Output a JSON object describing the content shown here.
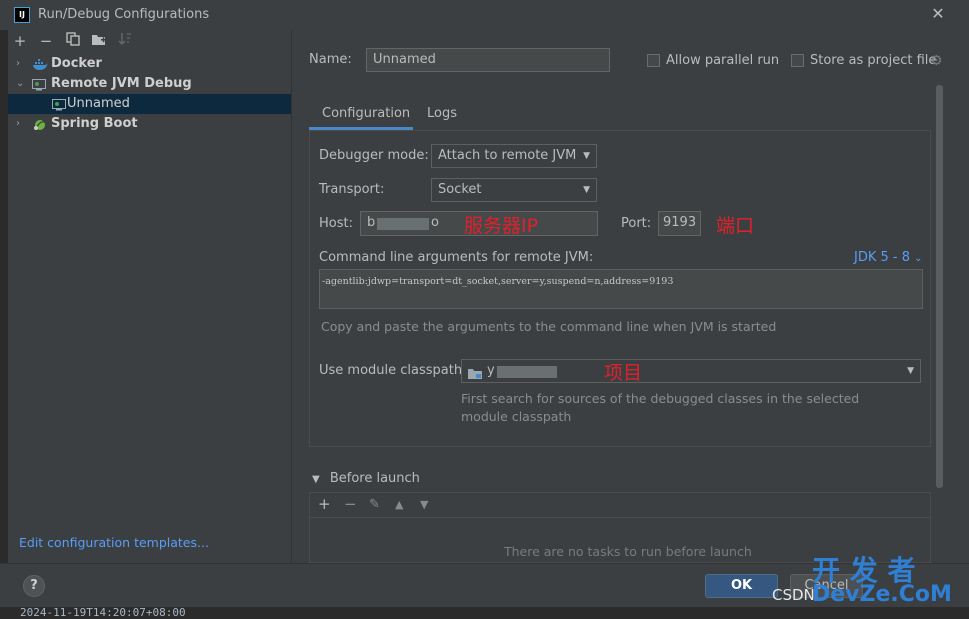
{
  "window": {
    "title": "Run/Debug Configurations",
    "app_icon": "IJ"
  },
  "toolbar": {
    "add": "+",
    "remove": "−",
    "copy_icon": "copy-icon",
    "folder_icon": "folder-plus-icon",
    "sort_icon": "sort-icon"
  },
  "tree": [
    {
      "label": "Docker",
      "expanded": false
    },
    {
      "label": "Remote JVM Debug",
      "expanded": true
    },
    {
      "label": "Unnamed",
      "selected": true
    },
    {
      "label": "Spring Boot",
      "expanded": false
    }
  ],
  "edit_templates": "Edit configuration templates...",
  "form": {
    "name_label": "Name:",
    "name_value": "Unnamed",
    "allow_parallel": "Allow parallel run",
    "store_project": "Store as project file",
    "tabs": [
      "Configuration",
      "Logs"
    ],
    "debugger_mode_label": "Debugger mode:",
    "debugger_mode_value": "Attach to remote JVM",
    "transport_label": "Transport:",
    "transport_value": "Socket",
    "host_label": "Host:",
    "host_value_prefix": "b",
    "host_value_suffix": "o",
    "host_annotation": "服务器IP",
    "port_label": "Port:",
    "port_value": "9193",
    "port_annotation": "端口",
    "cmd_label": "Command line arguments for remote JVM:",
    "jdk_link": "JDK 5 - 8",
    "cmd_value": "-agentlib:jdwp=transport=dt_socket,server=y,suspend=n,address=9193",
    "cmd_hint": "Copy and paste the arguments to the command line when JVM is started",
    "module_label": "Use module classpath:",
    "module_value_prefix": "y",
    "module_annotation": "项目",
    "module_hint_1": "First search for sources of the debugged classes in the selected",
    "module_hint_2": "module classpath"
  },
  "before_launch": {
    "label": "Before launch",
    "empty": "There are no tasks to run before launch"
  },
  "buttons": {
    "help": "?",
    "ok": "OK",
    "cancel": "Cancel"
  },
  "footer": {
    "timestamp": "2024-11-19T14:20:07+08:00",
    "csdn": "CSDN",
    "watermark_cn": "开 发 者",
    "watermark_en": "DevZe.CoM"
  },
  "colors": {
    "accent": "#4a88c7",
    "link": "#589df6",
    "annotation": "#e0212b",
    "ok_button": "#365880"
  }
}
